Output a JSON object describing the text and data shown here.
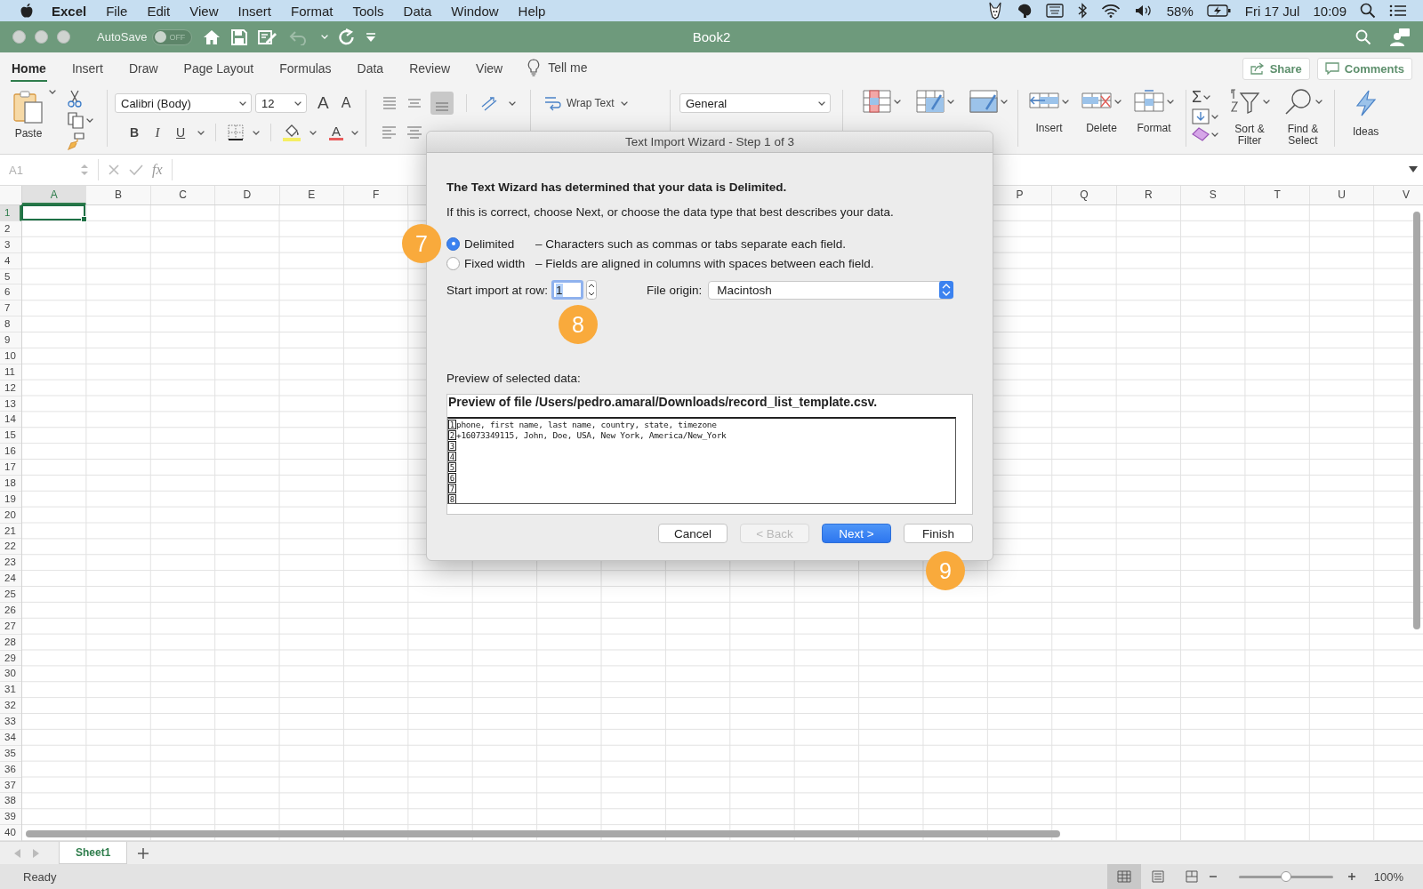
{
  "menu_bar": {
    "app": "Excel",
    "items": [
      "File",
      "Edit",
      "View",
      "Insert",
      "Format",
      "Tools",
      "Data",
      "Window",
      "Help"
    ],
    "battery": "58%",
    "date": "Fri 17 Jul",
    "time": "10:09"
  },
  "title_bar": {
    "autosave": "AutoSave",
    "autosave_toggle": {
      "label": "OFF",
      "on": false
    },
    "title": "Book2"
  },
  "ribbon_tabs": [
    {
      "label": "Home",
      "selected": true
    },
    {
      "label": "Insert",
      "selected": false
    },
    {
      "label": "Draw",
      "selected": false
    },
    {
      "label": "Page Layout",
      "selected": false
    },
    {
      "label": "Formulas",
      "selected": false
    },
    {
      "label": "Data",
      "selected": false
    },
    {
      "label": "Review",
      "selected": false
    },
    {
      "label": "View",
      "selected": false
    }
  ],
  "tell_me": "Tell me",
  "share": "Share",
  "comments": "Comments",
  "ribbon": {
    "paste": "Paste",
    "font": "Calibri (Body)",
    "font_size": "12",
    "grow_font": "A",
    "shrink_font": "A",
    "bold": "B",
    "italic": "I",
    "underline": "U",
    "font_color": "A",
    "wrap_text": "Wrap Text",
    "number_format": "General",
    "cells": [
      "Insert",
      "Delete",
      "Format"
    ],
    "autosum": "Σ",
    "sort_filter": "Sort & Filter",
    "find_select": "Find & Select",
    "ideas": "Ideas"
  },
  "formula_bar": {
    "name_box": "A1",
    "function": "fx"
  },
  "sheet": {
    "columns": [
      {
        "label": "A",
        "selected": true
      },
      {
        "label": "B",
        "selected": false
      },
      {
        "label": "C",
        "selected": false
      },
      {
        "label": "D",
        "selected": false
      },
      {
        "label": "E",
        "selected": false
      },
      {
        "label": "F",
        "selected": false
      },
      {
        "label": "P",
        "selected": false
      },
      {
        "label": "Q",
        "selected": false
      },
      {
        "label": "R",
        "selected": false
      },
      {
        "label": "S",
        "selected": false
      },
      {
        "label": "T",
        "selected": false
      },
      {
        "label": "U",
        "selected": false
      },
      {
        "label": "V",
        "selected": false
      }
    ],
    "rows": [
      {
        "label": "1",
        "selected": true
      },
      {
        "label": "2",
        "selected": false
      },
      {
        "label": "3",
        "selected": false
      },
      {
        "label": "4",
        "selected": false
      },
      {
        "label": "5",
        "selected": false
      },
      {
        "label": "6",
        "selected": false
      },
      {
        "label": "7",
        "selected": false
      },
      {
        "label": "8",
        "selected": false
      },
      {
        "label": "9",
        "selected": false
      },
      {
        "label": "10",
        "selected": false
      },
      {
        "label": "11",
        "selected": false
      },
      {
        "label": "12",
        "selected": false
      },
      {
        "label": "13",
        "selected": false
      },
      {
        "label": "14",
        "selected": false
      },
      {
        "label": "15",
        "selected": false
      },
      {
        "label": "16",
        "selected": false
      },
      {
        "label": "17",
        "selected": false
      },
      {
        "label": "18",
        "selected": false
      },
      {
        "label": "19",
        "selected": false
      },
      {
        "label": "20",
        "selected": false
      },
      {
        "label": "21",
        "selected": false
      },
      {
        "label": "22",
        "selected": false
      },
      {
        "label": "23",
        "selected": false
      },
      {
        "label": "24",
        "selected": false
      },
      {
        "label": "25",
        "selected": false
      },
      {
        "label": "26",
        "selected": false
      },
      {
        "label": "27",
        "selected": false
      },
      {
        "label": "28",
        "selected": false
      },
      {
        "label": "29",
        "selected": false
      },
      {
        "label": "30",
        "selected": false
      },
      {
        "label": "31",
        "selected": false
      },
      {
        "label": "32",
        "selected": false
      },
      {
        "label": "33",
        "selected": false
      },
      {
        "label": "34",
        "selected": false
      },
      {
        "label": "35",
        "selected": false
      },
      {
        "label": "36",
        "selected": false
      },
      {
        "label": "37",
        "selected": false
      },
      {
        "label": "38",
        "selected": false
      },
      {
        "label": "39",
        "selected": false
      },
      {
        "label": "40",
        "selected": false
      }
    ]
  },
  "dialog": {
    "title": "Text Import Wizard - Step 1 of 3",
    "heading": "The Text Wizard has determined that your data is Delimited.",
    "intro": "If this is correct, choose Next, or choose the data type that best describes your data.",
    "data_types": [
      {
        "label": "Delimited",
        "description": "– Characters such as commas or tabs separate each field.",
        "selected": true
      },
      {
        "label": "Fixed width",
        "description": "– Fields are aligned in columns with spaces between each field.",
        "selected": false
      }
    ],
    "start_row": {
      "label": "Start import at row:",
      "value": "1"
    },
    "file_origin": {
      "label": "File origin:",
      "value": "Macintosh"
    },
    "preview_label": "Preview of selected data:",
    "preview": {
      "header": "Preview of file /Users/pedro.amaral/Downloads/record_list_template.csv.",
      "lines": [
        {
          "number": "1",
          "text": "phone, first name, last name, country, state, timezone"
        },
        {
          "number": "2",
          "text": "+16073349115, John, Doe, USA, New York, America/New_York"
        },
        {
          "number": "3"
        },
        {
          "number": "4"
        },
        {
          "number": "5"
        },
        {
          "number": "6"
        },
        {
          "number": "7"
        },
        {
          "number": "8"
        }
      ]
    },
    "buttons": [
      {
        "label": "Cancel",
        "kind": "normal",
        "disabled": false
      },
      {
        "label": "< Back",
        "kind": "normal",
        "disabled": true
      },
      {
        "label": "Next >",
        "kind": "primary",
        "disabled": false
      },
      {
        "label": "Finish",
        "kind": "normal",
        "disabled": false
      }
    ]
  },
  "callouts": [
    {
      "label": "7"
    },
    {
      "label": "8"
    },
    {
      "label": "9"
    }
  ],
  "sheet_tabs": [
    {
      "label": "Sheet1",
      "selected": true
    }
  ],
  "status_bar": {
    "status": "Ready",
    "views": [
      {
        "kind": "normal",
        "selected": true
      },
      {
        "kind": "page_layout",
        "selected": false
      },
      {
        "kind": "page_break",
        "selected": false
      }
    ],
    "zoom": {
      "level": 0.5,
      "reading": "100%"
    }
  }
}
